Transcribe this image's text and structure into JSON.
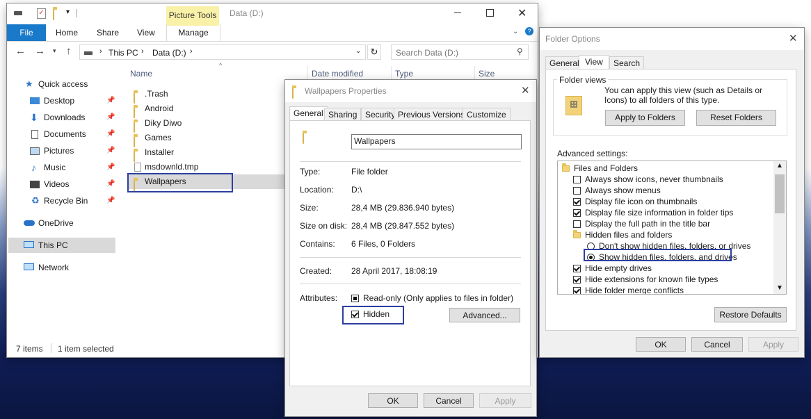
{
  "explorer": {
    "title": "Data (D:)",
    "picture_tools": "Picture Tools",
    "ribbon_tabs": [
      "File",
      "Home",
      "Share",
      "View",
      "Manage"
    ],
    "path": [
      "This PC",
      "Data (D:)"
    ],
    "search_placeholder": "Search Data (D:)",
    "columns": {
      "name": "Name",
      "date": "Date modified",
      "type": "Type",
      "size": "Size"
    },
    "nav": [
      {
        "label": "Quick access"
      },
      {
        "label": "Desktop"
      },
      {
        "label": "Downloads"
      },
      {
        "label": "Documents"
      },
      {
        "label": "Pictures"
      },
      {
        "label": "Music"
      },
      {
        "label": "Videos"
      },
      {
        "label": "Recycle Bin"
      },
      {
        "label": "OneDrive"
      },
      {
        "label": "This PC"
      },
      {
        "label": "Network"
      }
    ],
    "files": [
      ".Trash",
      "Android",
      "Diky Diwo",
      "Games",
      "Installer",
      "msdownld.tmp",
      "Wallpapers"
    ],
    "status_items": "7 items",
    "status_selected": "1 item selected"
  },
  "properties": {
    "title": "Wallpapers Properties",
    "tabs": [
      "General",
      "Sharing",
      "Security",
      "Previous Versions",
      "Customize"
    ],
    "name_value": "Wallpapers",
    "rows": [
      {
        "label": "Type:",
        "value": "File folder"
      },
      {
        "label": "Location:",
        "value": "D:\\"
      },
      {
        "label": "Size:",
        "value": "28,4 MB (29.836.940 bytes)"
      },
      {
        "label": "Size on disk:",
        "value": "28,4 MB (29.847.552 bytes)"
      },
      {
        "label": "Contains:",
        "value": "6 Files, 0 Folders"
      },
      {
        "label": "Created:",
        "value": "28 April 2017, 18:08:19"
      }
    ],
    "attributes_label": "Attributes:",
    "readonly_label": "Read-only (Only applies to files in folder)",
    "hidden_label": "Hidden",
    "advanced_label": "Advanced...",
    "ok": "OK",
    "cancel": "Cancel",
    "apply": "Apply"
  },
  "folder_options": {
    "title": "Folder Options",
    "tabs": [
      "General",
      "View",
      "Search"
    ],
    "folder_views_label": "Folder views",
    "folder_views_text": "You can apply this view (such as Details or Icons) to all folders of this type.",
    "apply_to_folders": "Apply to Folders",
    "reset_folders": "Reset Folders",
    "advanced_settings_label": "Advanced settings:",
    "tree": [
      {
        "label": "Files and Folders",
        "kind": "folder"
      },
      {
        "label": "Always show icons, never thumbnails",
        "kind": "check",
        "checked": false
      },
      {
        "label": "Always show menus",
        "kind": "check",
        "checked": false
      },
      {
        "label": "Display file icon on thumbnails",
        "kind": "check",
        "checked": true
      },
      {
        "label": "Display file size information in folder tips",
        "kind": "check",
        "checked": true
      },
      {
        "label": "Display the full path in the title bar",
        "kind": "check",
        "checked": false
      },
      {
        "label": "Hidden files and folders",
        "kind": "folder"
      },
      {
        "label": "Don't show hidden files, folders, or drives",
        "kind": "radio",
        "checked": false
      },
      {
        "label": "Show hidden files, folders, and drives",
        "kind": "radio",
        "checked": true
      },
      {
        "label": "Hide empty drives",
        "kind": "check",
        "checked": true
      },
      {
        "label": "Hide extensions for known file types",
        "kind": "check",
        "checked": true
      },
      {
        "label": "Hide folder merge conflicts",
        "kind": "check",
        "checked": true
      }
    ],
    "restore_defaults": "Restore Defaults",
    "ok": "OK",
    "cancel": "Cancel",
    "apply": "Apply"
  }
}
